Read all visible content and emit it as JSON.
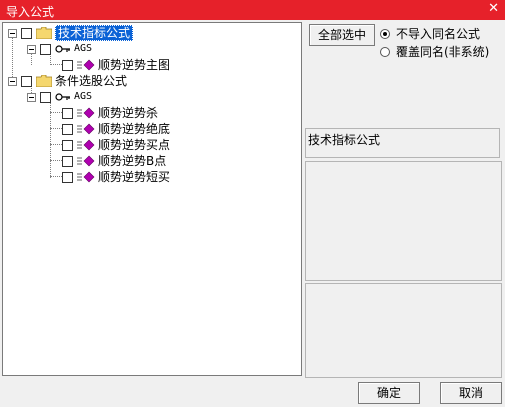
{
  "window": {
    "title": "导入公式",
    "close_glyph": "✕"
  },
  "tree": {
    "nodes": [
      {
        "label": "技术指标公式"
      },
      {
        "label": "AGS"
      },
      {
        "label": "顺势逆势主图"
      },
      {
        "label": "条件选股公式"
      },
      {
        "label": "AGS"
      },
      {
        "label": "顺势逆势杀"
      },
      {
        "label": "顺势逆势绝底"
      },
      {
        "label": "顺势逆势买点"
      },
      {
        "label": "顺势逆势B点"
      },
      {
        "label": "顺势逆势短买"
      }
    ]
  },
  "side": {
    "select_all_label": "全部选中",
    "options": [
      {
        "label": "不导入同名公式",
        "selected": true
      },
      {
        "label": "覆盖同名(非系统)",
        "selected": false
      }
    ],
    "info_text": "技术指标公式"
  },
  "footer": {
    "ok_label": "确定",
    "cancel_label": "取消"
  },
  "colors": {
    "titlebar": "#e6212a",
    "selection": "#0a62d6",
    "folder": "#f5d76e",
    "formula": "#b000b0"
  }
}
